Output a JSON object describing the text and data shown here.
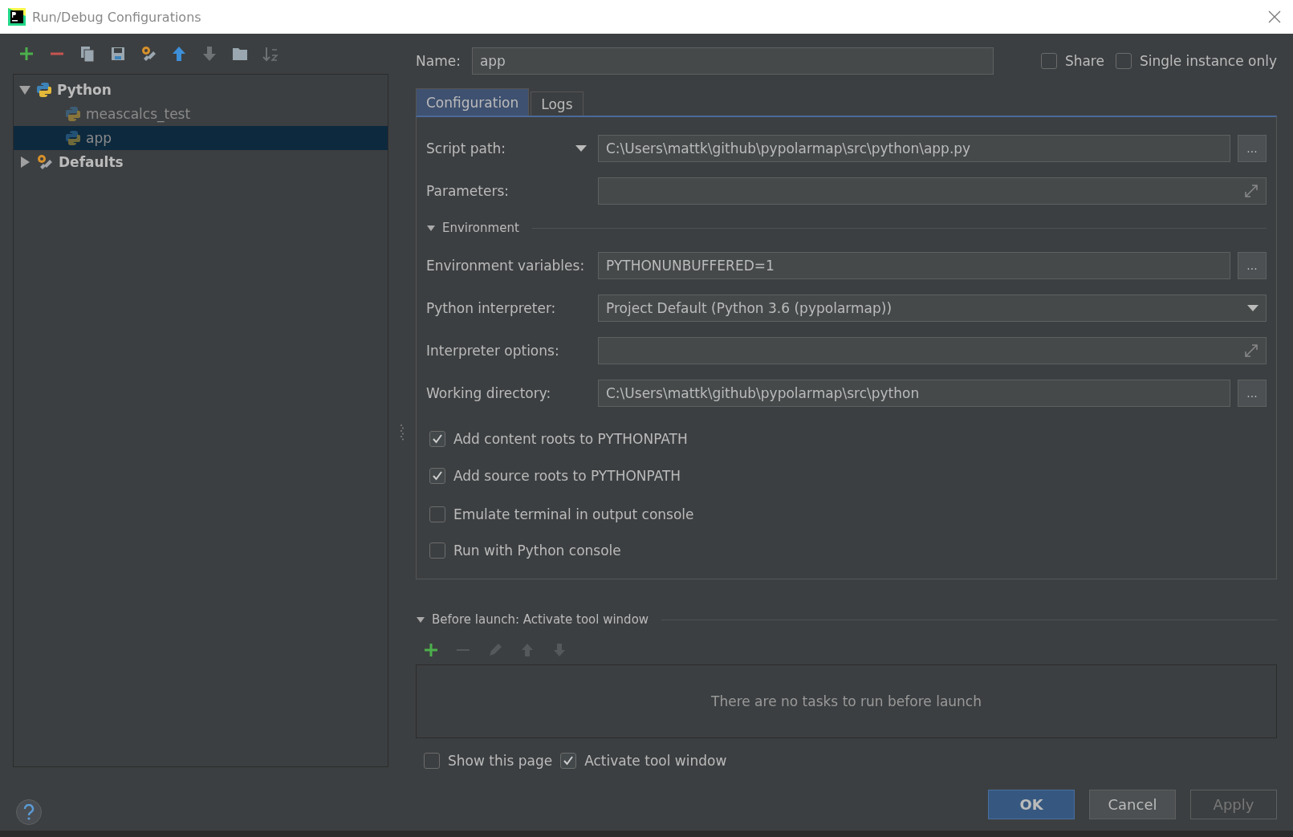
{
  "window": {
    "title": "Run/Debug Configurations"
  },
  "tree": [
    {
      "label": "Python",
      "kind": "python",
      "expanded": true,
      "selected": false,
      "children": [
        {
          "label": "meascalcs_test",
          "kind": "python",
          "selected": false
        },
        {
          "label": "app",
          "kind": "python",
          "selected": true
        }
      ]
    },
    {
      "label": "Defaults",
      "kind": "defaults",
      "expanded": false,
      "selected": false
    }
  ],
  "name": {
    "label": "Name:",
    "value": "app"
  },
  "options": [
    {
      "label": "Share",
      "checked": false
    },
    {
      "label": "Single instance only",
      "checked": false
    }
  ],
  "tabs": [
    {
      "label": "Configuration",
      "selected": true
    },
    {
      "label": "Logs",
      "selected": false
    }
  ],
  "fields": [
    {
      "kind": "browse",
      "label": "Script path:",
      "menu": true,
      "value": "C:\\Users\\mattk\\github\\pypolarmap\\src\\python\\app.py",
      "button": "..."
    },
    {
      "kind": "expand",
      "label": "Parameters:"
    },
    {
      "kind": "section",
      "label": "Environment",
      "expanded": true
    },
    {
      "kind": "browse",
      "label": "Environment variables:",
      "value": "PYTHONUNBUFFERED=1",
      "button": "..."
    },
    {
      "kind": "select",
      "label": "Python interpreter:",
      "value": "Project Default (Python 3.6 (pypolarmap))"
    },
    {
      "kind": "expand",
      "label": "Interpreter options:"
    },
    {
      "kind": "browse",
      "label": "Working directory:",
      "value": "C:\\Users\\mattk\\github\\pypolarmap\\src\\python",
      "button": "..."
    }
  ],
  "checks": [
    {
      "label": "Add content roots to PYTHONPATH",
      "checked": true
    },
    {
      "label": "Add source roots to PYTHONPATH",
      "checked": true
    },
    {
      "label": "Emulate terminal in output console",
      "checked": false
    },
    {
      "label": "Run with Python console",
      "checked": false
    }
  ],
  "before_launch": {
    "title": "Before launch: Activate tool window",
    "expanded": true,
    "empty_text": "There are no tasks to run before launch",
    "options": [
      {
        "label": "Show this page",
        "checked": false
      },
      {
        "label": "Activate tool window",
        "checked": true
      }
    ]
  },
  "buttons": [
    {
      "label": "OK",
      "kind": "default",
      "disabled": false
    },
    {
      "label": "Cancel",
      "kind": "normal",
      "disabled": false
    },
    {
      "label": "Apply",
      "kind": "normal",
      "disabled": true
    }
  ]
}
